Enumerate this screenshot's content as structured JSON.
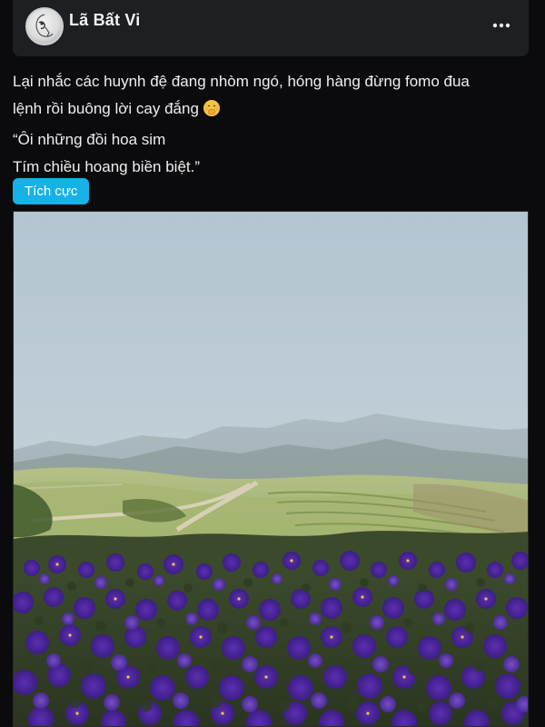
{
  "post": {
    "author_name": "Lã Bất Vi",
    "text_lines": [
      "Lại nhắc các huynh đệ đang nhòm ngó, hóng hàng đừng fomo đua",
      "lệnh rồi buông lời cay đắng",
      "“Ôi những đồi hoa sim",
      "Tím chiều hoang biền biệt.”"
    ],
    "emoji": "face-with-hand-over-mouth-icon",
    "tag_label": "Tích cực"
  },
  "colors": {
    "background": "#0b0b0d",
    "card": "#1e1f23",
    "text": "#eeeeee",
    "tag": "#16b1e6"
  },
  "icons": {
    "more": "more-horizontal-icon",
    "avatar": "avatar-image"
  }
}
